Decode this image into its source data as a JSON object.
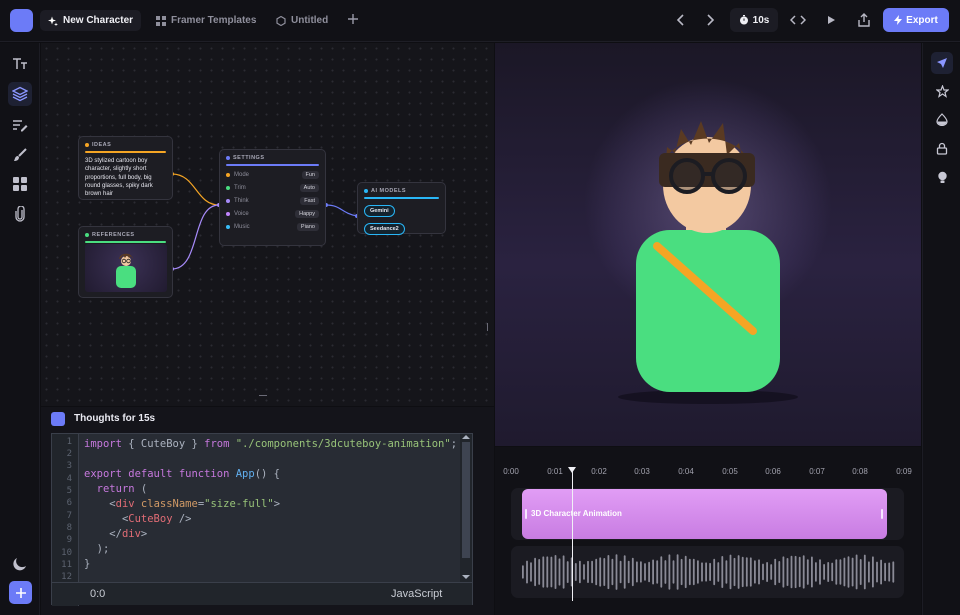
{
  "header": {
    "tabs": [
      {
        "label": "New Character",
        "icon": "sparkle-icon",
        "active": true
      },
      {
        "label": "Framer Templates",
        "icon": "grid-icon",
        "active": false
      },
      {
        "label": "Untitled",
        "icon": "hexagon-icon",
        "active": false
      }
    ],
    "duration": "10s",
    "export_label": "Export"
  },
  "nodes": {
    "ideas": {
      "title": "IDEAS",
      "text": "3D stylized cartoon boy character, slightly short proportions, full body, big round glasses, spiky dark brown hair",
      "accent": "#f5a524"
    },
    "references": {
      "title": "REFERENCES",
      "accent": "#4ade80"
    },
    "settings": {
      "title": "SETTINGS",
      "accent": "#6c7bf7",
      "rows": [
        {
          "key": "Mode",
          "value": "Fun",
          "color": "#f5a524"
        },
        {
          "key": "Trim",
          "value": "Auto",
          "color": "#4ade80"
        },
        {
          "key": "Think",
          "value": "Fast",
          "color": "#a78bfa"
        },
        {
          "key": "Voice",
          "value": "Happy",
          "color": "#c084fc"
        },
        {
          "key": "Music",
          "value": "Piano",
          "color": "#38bdf8"
        }
      ]
    },
    "ai_models": {
      "title": "AI MODELS",
      "accent": "#29b6f6",
      "models": [
        "Gemini",
        "Seedance2"
      ]
    }
  },
  "thoughts": {
    "title": "Thoughts for 15s",
    "line_numbers": [
      "1",
      "2",
      "3",
      "4",
      "5",
      "6",
      "7",
      "8",
      "9",
      "10",
      "11",
      "12"
    ],
    "code": {
      "l1_kw": "import",
      "l1_b": " { CuteBoy } ",
      "l1_kw2": "from",
      "l1_str": "\"./components/3dcuteboy-animation\"",
      "l1_end": ";",
      "l3_kw": "export default function",
      "l3_fn": "App",
      "l3_end": "() {",
      "l4_kw": "return",
      "l4_end": " (",
      "l5_a": "<",
      "l5_tag": "div",
      "l5_attr": "className",
      "l5_eq": "=",
      "l5_str": "\"size-full\"",
      "l5_end": ">",
      "l6_a": "<",
      "l6_tag": "CuteBoy",
      "l6_end": " />",
      "l7_a": "</",
      "l7_tag": "div",
      "l7_end": ">",
      "l8": ");",
      "l9": "}"
    },
    "cursor_position": "0:0",
    "language": "JavaScript"
  },
  "timeline": {
    "ticks": [
      "0:00",
      "0:01",
      "0:02",
      "0:03",
      "0:04",
      "0:05",
      "0:06",
      "0:07",
      "0:08",
      "0:09"
    ],
    "clip_label": "3D Character Animation",
    "playhead_time": 1.4
  },
  "colors": {
    "accent": "#6c7bf7",
    "clip": "#d98cf0",
    "shirt": "#4ade80",
    "strap": "#f5a524"
  }
}
